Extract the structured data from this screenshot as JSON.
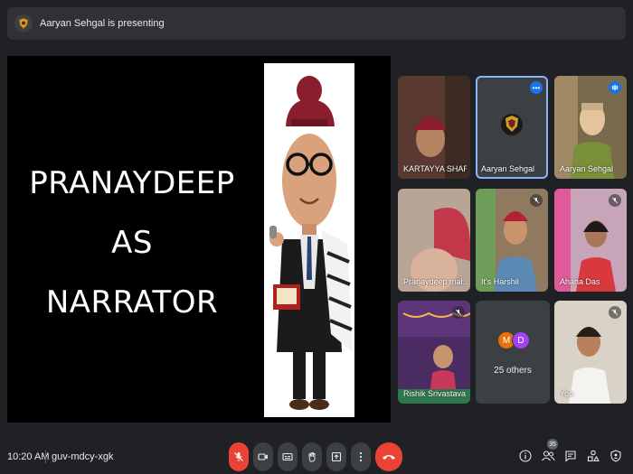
{
  "presenting_bar": {
    "text": "Aaryan Sehgal is presenting"
  },
  "slide": {
    "lines": [
      "PRANAYDEEP",
      "AS",
      "NARRATOR"
    ]
  },
  "participants": [
    {
      "name": "KARTAYYA SHAR...",
      "bg": "#6b4a3d"
    },
    {
      "name": "Aaryan Sehgal",
      "bg": "#3c4043",
      "active": true
    },
    {
      "name": "Aaryan Sehgal",
      "bg": "#7a6a4c"
    },
    {
      "name": "Pranaydeep mal...",
      "bg": "#9a7f6d"
    },
    {
      "name": "It's Harshil",
      "bg": "#8f7a60"
    },
    {
      "name": "Ahana Das",
      "bg": "#c8a4b8"
    },
    {
      "name": "Rishik Srivastava",
      "bg": "#4a2c63"
    },
    {
      "name": "You",
      "bg": "#d9d2c6"
    }
  ],
  "others": {
    "label": "25 others",
    "avatars": [
      {
        "letter": "M",
        "color": "#e8710a"
      },
      {
        "letter": "D",
        "color": "#a142f4"
      }
    ]
  },
  "bottom_bar": {
    "time": "10:20 AM",
    "meeting_code": "guv-mdcy-xgk",
    "people_count": "35"
  },
  "colors": {
    "background": "#202124",
    "tile": "#3c4043",
    "danger": "#ea4335",
    "accent": "#8ab4f8"
  },
  "icons": {
    "mic": "mic-off-icon",
    "camera": "camera-icon",
    "captions": "captions-icon",
    "hand": "raise-hand-icon",
    "present": "present-icon",
    "more": "more-options-icon",
    "end": "end-call-icon",
    "info": "info-icon",
    "people": "people-icon",
    "chat": "chat-icon",
    "activities": "activities-icon",
    "host": "host-controls-icon"
  }
}
